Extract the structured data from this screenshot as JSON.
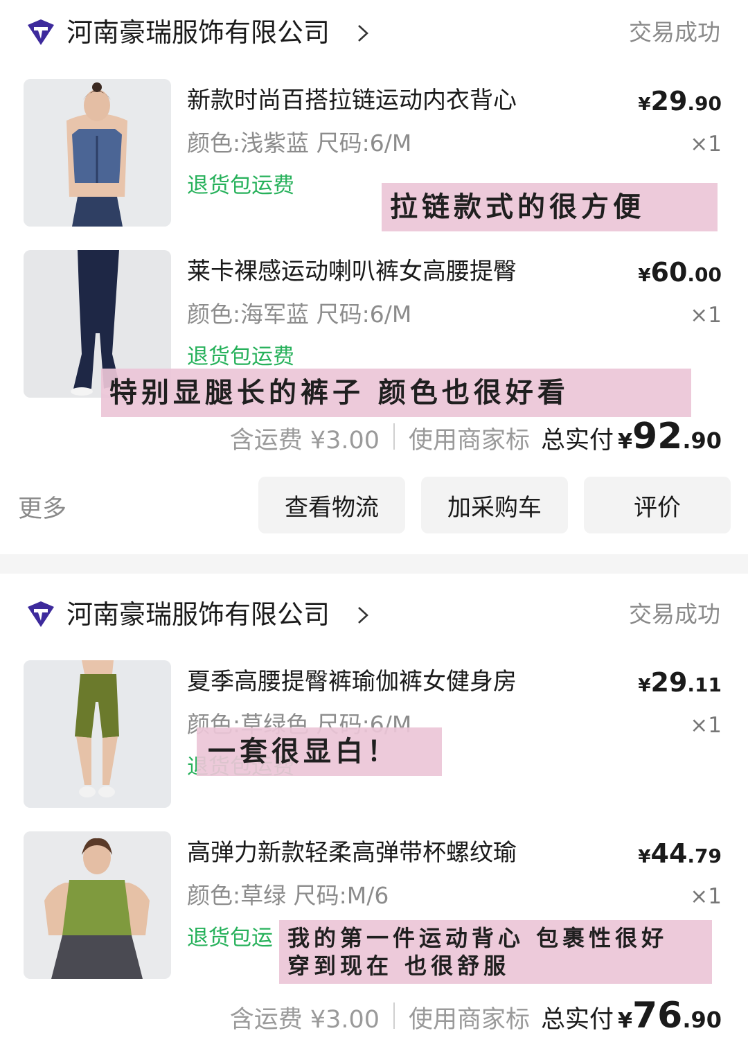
{
  "orders": [
    {
      "shop_name": "河南豪瑞服饰有限公司",
      "status": "交易成功",
      "items": [
        {
          "title": "新款时尚百搭拉链运动内衣背心",
          "spec": "颜色:浅紫蓝 尺码:6/M",
          "tag": "退货包运费",
          "price_currency": "¥",
          "price_int": "29",
          "price_dec": ".90",
          "qty": "×1",
          "thumb": "blue-zip-sports-bra-photo"
        },
        {
          "title": "莱卡裸感运动喇叭裤女高腰提臀",
          "spec": "颜色:海军蓝 尺码:6/M",
          "tag": "退货包运费",
          "price_currency": "¥",
          "price_int": "60",
          "price_dec": ".00",
          "qty": "×1",
          "thumb": "navy-flare-pants-photo"
        }
      ],
      "summary": {
        "shipping": "含运费 ¥3.00",
        "note": "使用商家标",
        "total_label": "总实付",
        "total_currency": "¥",
        "total_int": "92",
        "total_dec": ".90"
      },
      "actions": {
        "more": "更多",
        "buttons": [
          "查看物流",
          "加采购车",
          "评价"
        ]
      }
    },
    {
      "shop_name": "河南豪瑞服饰有限公司",
      "status": "交易成功",
      "items": [
        {
          "title": "夏季高腰提臀裤瑜伽裤女健身房",
          "spec": "颜色:草绿色 尺码:6/M",
          "tag": "退货包运费",
          "price_currency": "¥",
          "price_int": "29",
          "price_dec": ".11",
          "qty": "×1",
          "thumb": "green-biker-shorts-photo"
        },
        {
          "title": "高弹力新款轻柔高弹带杯螺纹瑜",
          "spec": "颜色:草绿 尺码:M/6",
          "tag": "退货包运",
          "price_currency": "¥",
          "price_int": "44",
          "price_dec": ".79",
          "qty": "×1",
          "thumb": "green-tank-top-photo"
        }
      ],
      "summary": {
        "shipping": "含运费 ¥3.00",
        "note": "使用商家标",
        "total_label": "总实付",
        "total_currency": "¥",
        "total_int": "76",
        "total_dec": ".90"
      }
    }
  ],
  "annotations": [
    "拉链款式的很方便",
    "特别显腿长的裤子 颜色也很好看",
    "一套很显白！",
    "我的第一件运动背心 包裹性很好",
    "穿到现在 也很舒服"
  ],
  "colors": {
    "tag_green": "#27b15b",
    "logo_purple": "#3d2a9c",
    "note_pink": "#ecc6d7",
    "button_bg": "#f3f3f3"
  }
}
